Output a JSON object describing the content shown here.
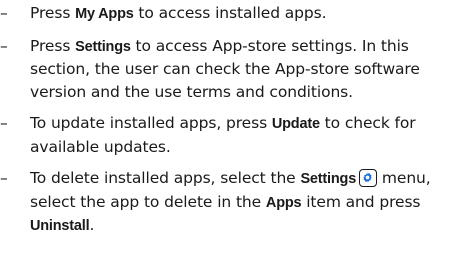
{
  "bullets": [
    {
      "dash": "–",
      "t1": "Press ",
      "k1": "My Apps",
      "t2": " to access installed apps."
    },
    {
      "dash": "–",
      "t1": "Press ",
      "k1": "Settings",
      "t2": " to access App-store settings. In this section, the user can check the App-store software version and the use terms and conditions."
    },
    {
      "dash": "–",
      "t1": "To update installed apps, press ",
      "k1": "Update",
      "t2": " to check for available updates."
    },
    {
      "dash": "–",
      "t1": "To delete installed apps, select the ",
      "k1": "Settings",
      "t2": " menu, select the app to delete in the ",
      "k2": "Apps",
      "t3": " item and press ",
      "k3": "Uninstall",
      "t4": "."
    }
  ],
  "icons": {
    "settings_icon": "gear-icon",
    "accent": "#1e6fd9"
  }
}
